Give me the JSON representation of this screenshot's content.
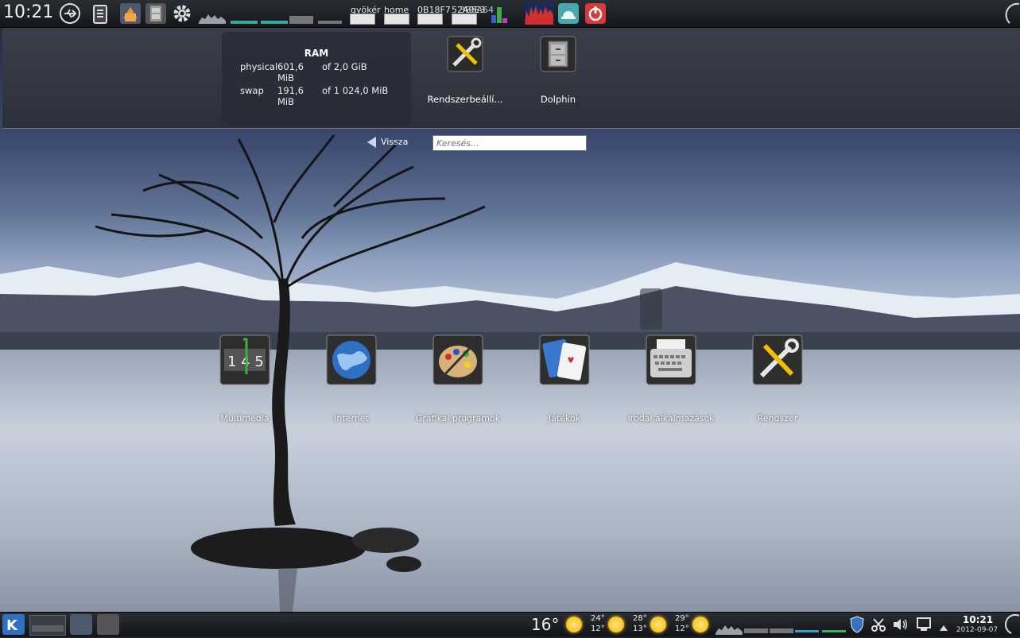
{
  "top_panel": {
    "clock": "10:21",
    "devices": [
      {
        "label": "gyökér"
      },
      {
        "label": "home"
      },
      {
        "label": "0B18F7"
      },
      {
        "label": "52A9E3"
      },
      {
        "label": "3B5A64"
      }
    ]
  },
  "ram_widget": {
    "title": "RAM",
    "rows": [
      {
        "name": "physical",
        "used": "601,6 MiB",
        "total": "of 2,0 GiB"
      },
      {
        "name": "swap",
        "used": "191,6 MiB",
        "total": "of 1 024,0 MiB"
      }
    ]
  },
  "favorites": [
    {
      "label": "Rendszerbeállí...",
      "icon": "settings-tools-icon"
    },
    {
      "label": "Dolphin",
      "icon": "file-cabinet-icon"
    }
  ],
  "navigation": {
    "back_label": "Vissza",
    "search_placeholder": "Keresés..."
  },
  "categories": [
    {
      "label": "Multimédia",
      "icon": "multimedia-icon"
    },
    {
      "label": "Internet",
      "icon": "globe-icon"
    },
    {
      "label": "Grafikai programok",
      "icon": "palette-icon"
    },
    {
      "label": "Játékok",
      "icon": "cards-icon"
    },
    {
      "label": "Irodai alkalmazások",
      "icon": "typewriter-icon"
    },
    {
      "label": "Rendszer",
      "icon": "tools-icon"
    }
  ],
  "bottom_panel": {
    "current_temp": "16°",
    "forecast": [
      {
        "high": "24°",
        "low": "12°"
      },
      {
        "high": "28°",
        "low": "13°"
      },
      {
        "high": "29°",
        "low": "12°"
      }
    ],
    "clock": "10:21",
    "date": "2012-09-07"
  },
  "colors": {
    "panel": "#1c1e22",
    "kde_blue": "#2f6fc4",
    "sun": "#f5b400"
  }
}
